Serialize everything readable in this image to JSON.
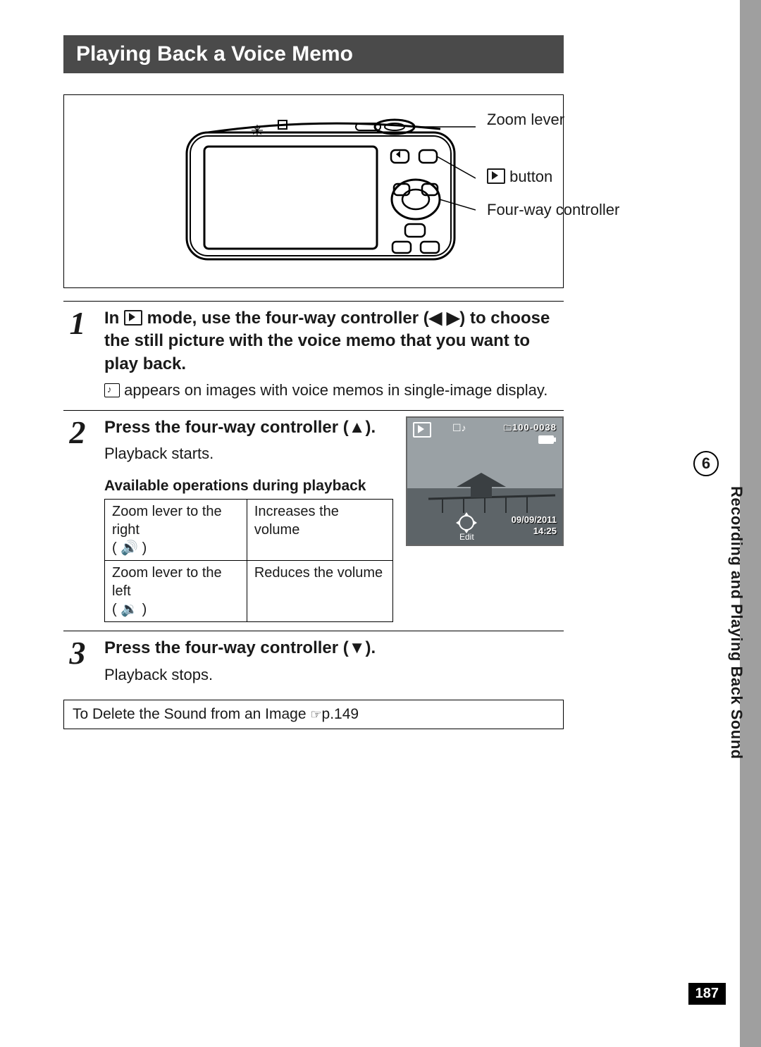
{
  "section_title": "Playing Back a Voice Memo",
  "figure": {
    "labels": {
      "zoom_lever": "Zoom lever",
      "play_button_suffix": " button",
      "four_way": "Four-way controller"
    }
  },
  "steps": {
    "s1": {
      "num": "1",
      "head_pre": "In ",
      "head_post": " mode, use the four-way controller (◀ ▶) to choose the still picture with the voice memo that you want to play back.",
      "sub_post": " appears on images with voice memos in single-image display."
    },
    "s2": {
      "num": "2",
      "head": "Press the four-way controller (▲).",
      "sub": "Playback starts.",
      "subhead": "Available operations during playback",
      "table": {
        "r1c1a": "Zoom lever to the right",
        "r1c1b": "( 🔊 )",
        "r1c2": "Increases the volume",
        "r2c1a": "Zoom lever to the left",
        "r2c1b": "( 🔉 )",
        "r2c2": "Reduces the volume"
      },
      "thumb": {
        "file_no": "100-0038",
        "date": "09/09/2011",
        "time": "14:25",
        "edit": "Edit"
      }
    },
    "s3": {
      "num": "3",
      "head": "Press the four-way controller (▼).",
      "sub": "Playback stops."
    }
  },
  "xref": {
    "text": "To Delete the Sound from an Image ",
    "page_ref": "p.149"
  },
  "sidebar": {
    "chapter_num": "6",
    "chapter_title": "Recording and Playing Back Sound"
  },
  "page_number": "187"
}
